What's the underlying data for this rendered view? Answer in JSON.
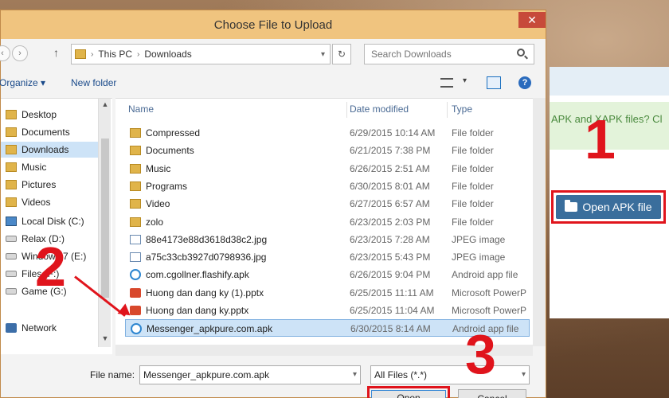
{
  "dialog": {
    "title": "Choose File to Upload",
    "close_glyph": "✕",
    "address": {
      "root": "This PC",
      "current": "Downloads"
    },
    "search_placeholder": "Search Downloads",
    "toolbar": {
      "organize": "Organize ▾",
      "new_folder": "New folder"
    },
    "nav_items": [
      {
        "label": "Desktop",
        "icon": "folder-icon"
      },
      {
        "label": "Documents",
        "icon": "folder-icon"
      },
      {
        "label": "Downloads",
        "icon": "folder-icon",
        "selected": true
      },
      {
        "label": "Music",
        "icon": "folder-icon"
      },
      {
        "label": "Pictures",
        "icon": "folder-icon"
      },
      {
        "label": "Videos",
        "icon": "folder-icon"
      },
      {
        "label": "Local Disk (C:)",
        "icon": "system-drive-icon"
      },
      {
        "label": "Relax (D:)",
        "icon": "drive-icon"
      },
      {
        "label": "Windows 7 (E:)",
        "icon": "drive-icon"
      },
      {
        "label": "Files (F:)",
        "icon": "drive-icon"
      },
      {
        "label": "Game (G:)",
        "icon": "drive-icon"
      },
      {
        "label": "Network",
        "icon": "network-icon"
      }
    ],
    "columns": {
      "name": "Name",
      "date": "Date modified",
      "type": "Type"
    },
    "files": [
      {
        "name": "Compressed",
        "date": "6/29/2015 10:14 AM",
        "type": "File folder",
        "icon": "folder-icon"
      },
      {
        "name": "Documents",
        "date": "6/21/2015 7:38 PM",
        "type": "File folder",
        "icon": "folder-icon"
      },
      {
        "name": "Music",
        "date": "6/26/2015 2:51 AM",
        "type": "File folder",
        "icon": "folder-icon"
      },
      {
        "name": "Programs",
        "date": "6/30/2015 8:01 AM",
        "type": "File folder",
        "icon": "folder-icon"
      },
      {
        "name": "Video",
        "date": "6/27/2015 6:57 AM",
        "type": "File folder",
        "icon": "folder-icon"
      },
      {
        "name": "zolo",
        "date": "6/23/2015 2:03 PM",
        "type": "File folder",
        "icon": "folder-icon"
      },
      {
        "name": "88e4173e88d3618d38c2.jpg",
        "date": "6/23/2015 7:28 AM",
        "type": "JPEG image",
        "icon": "image-icon"
      },
      {
        "name": "a75c33cb3927d0798936.jpg",
        "date": "6/23/2015 5:43 PM",
        "type": "JPEG image",
        "icon": "image-icon"
      },
      {
        "name": "com.cgollner.flashify.apk",
        "date": "6/26/2015 9:04 PM",
        "type": "Android app file",
        "icon": "apk-icon"
      },
      {
        "name": "Huong dan dang ky (1).pptx",
        "date": "6/25/2015 11:11 AM",
        "type": "Microsoft PowerP",
        "icon": "pptx-icon"
      },
      {
        "name": "Huong dan dang ky.pptx",
        "date": "6/25/2015 11:04 AM",
        "type": "Microsoft PowerP",
        "icon": "pptx-icon"
      },
      {
        "name": "Messenger_apkpure.com.apk",
        "date": "6/30/2015 8:14 AM",
        "type": "Android app file",
        "icon": "apk-icon",
        "selected": true
      }
    ],
    "file_name_label": "File name:",
    "file_name_value": "Messenger_apkpure.com.apk",
    "file_type_value": "All Files (*.*)",
    "open_label": "Open",
    "cancel_label": "Cancel"
  },
  "webpage": {
    "notice": "APK and XAPK files? Cl",
    "open_apk_label": "Open APK file"
  },
  "callouts": {
    "one": "1",
    "two": "2",
    "three": "3"
  },
  "colors": {
    "highlight": "#e0141c",
    "titlebar": "#f0c47f",
    "apk_button": "#3a6e9c",
    "selection": "#cde3f7"
  }
}
